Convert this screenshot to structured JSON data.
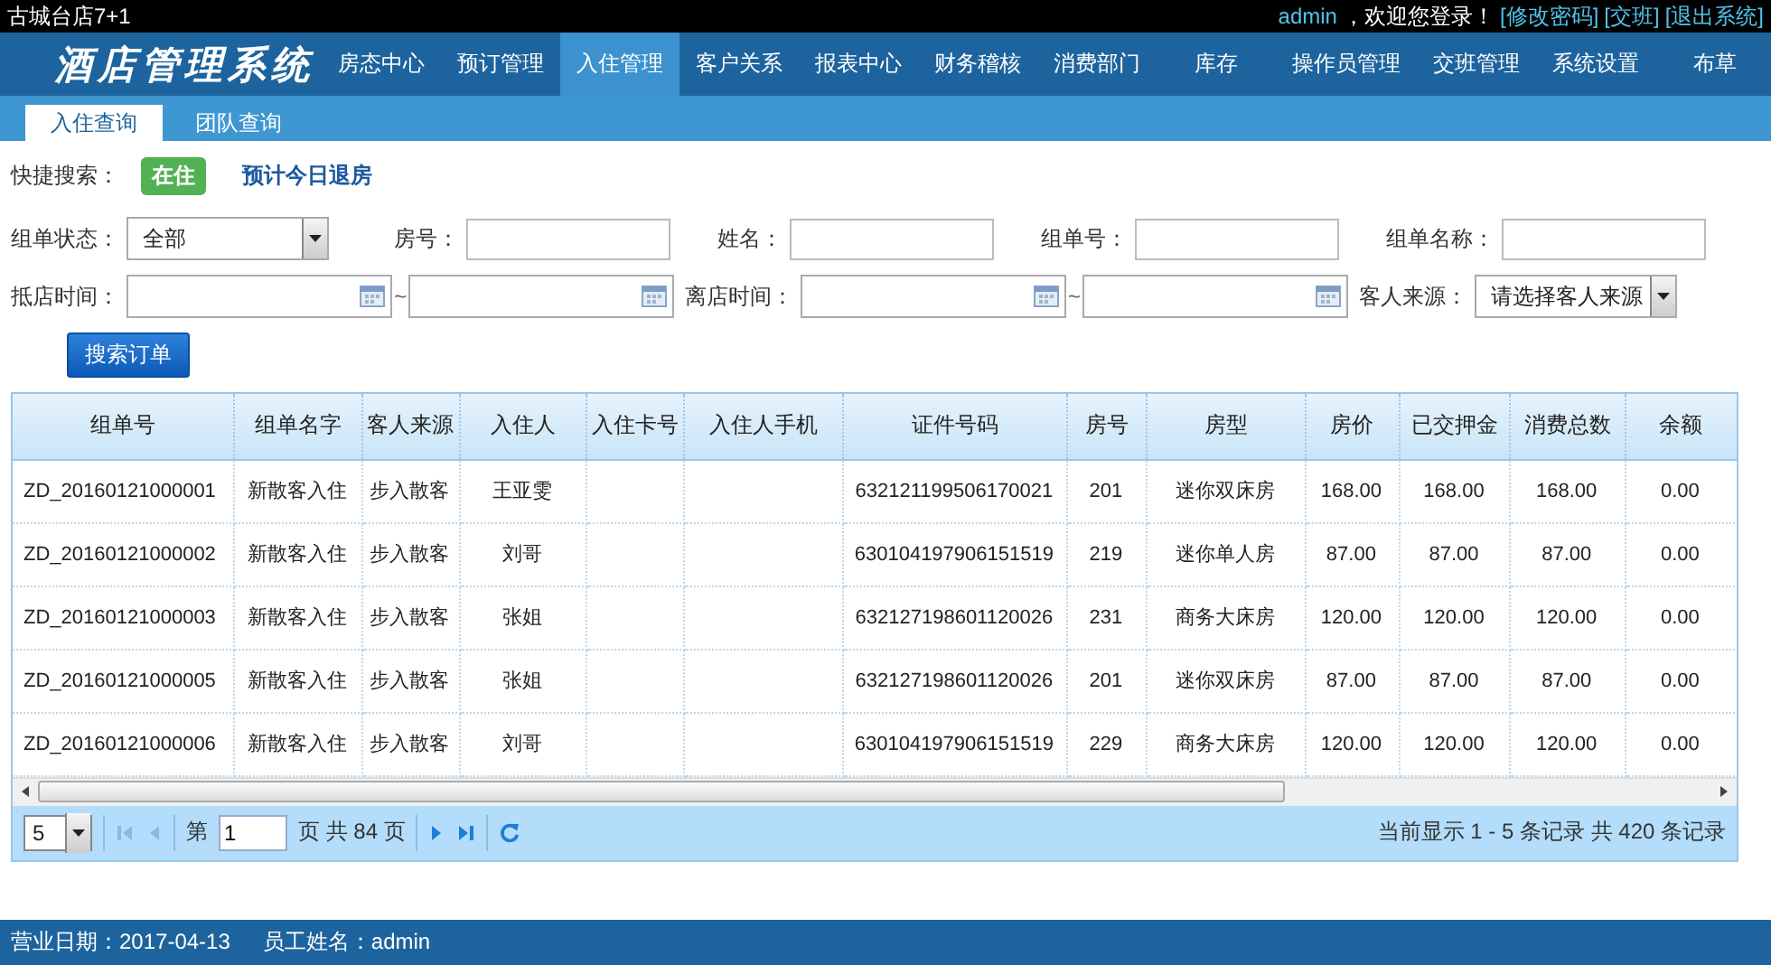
{
  "top_bar": {
    "store": "古城台店7+1",
    "user": "admin",
    "welcome": "，欢迎您登录！",
    "links": [
      "[修改密码]",
      "[交班]",
      "[退出系统]"
    ]
  },
  "header": {
    "logo": "酒店管理系统",
    "nav": [
      {
        "label": "房态中心",
        "selected": false
      },
      {
        "label": "预订管理",
        "selected": false
      },
      {
        "label": "入住管理",
        "selected": true
      },
      {
        "label": "客户关系",
        "selected": false
      },
      {
        "label": "报表中心",
        "selected": false
      },
      {
        "label": "财务稽核",
        "selected": false
      },
      {
        "label": "消费部门",
        "selected": false
      },
      {
        "label": "库存",
        "selected": false
      },
      {
        "label": "操作员管理",
        "selected": false
      },
      {
        "label": "交班管理",
        "selected": false
      },
      {
        "label": "系统设置",
        "selected": false
      },
      {
        "label": "布草",
        "selected": false
      }
    ]
  },
  "subtabs": [
    {
      "label": "入住查询",
      "selected": true
    },
    {
      "label": "团队查询",
      "selected": false
    }
  ],
  "quick_search": {
    "label": "快捷搜索：",
    "items": [
      {
        "kind": "badge",
        "label": "在住"
      },
      {
        "kind": "link",
        "label": "预计今日退房"
      }
    ]
  },
  "filters": [
    [
      {
        "kind": "select",
        "label": "组单状态：",
        "value": "全部"
      },
      {
        "kind": "input",
        "label": "房号："
      },
      {
        "kind": "input",
        "label": "姓名："
      },
      {
        "kind": "input",
        "label": "组单号："
      },
      {
        "kind": "input",
        "label": "组单名称："
      }
    ],
    [
      {
        "kind": "date_range",
        "label": "抵店时间：",
        "separator": "~"
      },
      {
        "kind": "date_range",
        "label": "离店时间：",
        "separator": "~"
      },
      {
        "kind": "select",
        "label": "客人来源：",
        "value": "请选择客人来源"
      }
    ]
  ],
  "search_button": "搜索订单",
  "table": {
    "columns": [
      "组单号",
      "组单名字",
      "客人来源",
      "入住人",
      "入住卡号",
      "入住人手机",
      "证件号码",
      "房号",
      "房型",
      "房价",
      "已交押金",
      "消费总数",
      "余额"
    ],
    "rows": [
      [
        "ZD_20160121000001",
        "新散客入住",
        "步入散客",
        "王亚雯",
        "",
        "",
        "632121199506170021",
        "201",
        "迷你双床房",
        "168.00",
        "168.00",
        "168.00",
        "0.00"
      ],
      [
        "ZD_20160121000002",
        "新散客入住",
        "步入散客",
        "刘哥",
        "",
        "",
        "630104197906151519",
        "219",
        "迷你单人房",
        "87.00",
        "87.00",
        "87.00",
        "0.00"
      ],
      [
        "ZD_20160121000003",
        "新散客入住",
        "步入散客",
        "张姐",
        "",
        "",
        "632127198601120026",
        "231",
        "商务大床房",
        "120.00",
        "120.00",
        "120.00",
        "0.00"
      ],
      [
        "ZD_20160121000005",
        "新散客入住",
        "步入散客",
        "张姐",
        "",
        "",
        "632127198601120026",
        "201",
        "迷你双床房",
        "87.00",
        "87.00",
        "87.00",
        "0.00"
      ],
      [
        "ZD_20160121000006",
        "新散客入住",
        "步入散客",
        "刘哥",
        "",
        "",
        "630104197906151519",
        "229",
        "商务大床房",
        "120.00",
        "120.00",
        "120.00",
        "0.00"
      ]
    ]
  },
  "pager": {
    "page_size": "5",
    "page_prefix": "第",
    "page": "1",
    "page_suffix": "页 共 84 页",
    "summary": "当前显示 1 - 5 条记录 共 420 条记录"
  },
  "status_bar": {
    "business_date": "营业日期：2017-04-13",
    "employee": "员工姓名：admin"
  }
}
